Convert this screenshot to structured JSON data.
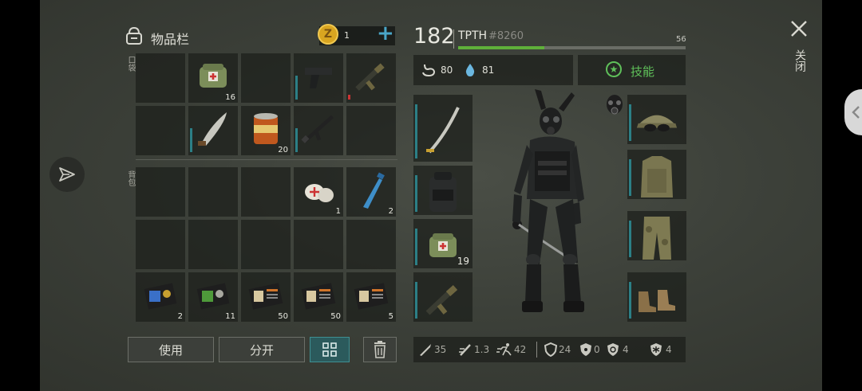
{
  "inventory": {
    "title": "物品栏",
    "coin_count": "1",
    "plus": "+",
    "pocket_label": "口袋",
    "backpack_label": "背包",
    "pocket_slots": [
      {
        "name": "empty"
      },
      {
        "name": "medical-bag",
        "count": "16"
      },
      {
        "name": "empty"
      },
      {
        "name": "pistol"
      },
      {
        "name": "rifle-grenade-launcher"
      },
      {
        "name": "empty"
      },
      {
        "name": "machete"
      },
      {
        "name": "food-can",
        "count": "20"
      },
      {
        "name": "assault-rifle"
      },
      {
        "name": "empty"
      }
    ],
    "backpack_slots": [
      {
        "name": "empty"
      },
      {
        "name": "empty"
      },
      {
        "name": "empty"
      },
      {
        "name": "bandage",
        "count": "1"
      },
      {
        "name": "water-bottle",
        "count": "2"
      },
      {
        "name": "empty"
      },
      {
        "name": "empty"
      },
      {
        "name": "empty"
      },
      {
        "name": "empty"
      },
      {
        "name": "empty"
      },
      {
        "name": "blue-keycard",
        "count": "2"
      },
      {
        "name": "green-keycard",
        "count": "11"
      },
      {
        "name": "recipe-book",
        "count": "50"
      },
      {
        "name": "recipe-book",
        "count": "50"
      },
      {
        "name": "recipe-book",
        "count": "5"
      }
    ],
    "use_button": "使用",
    "split_button": "分开"
  },
  "player": {
    "level": "182",
    "name": "TPTH",
    "tag": "#8260",
    "level_progress_value": "56",
    "level_progress_fraction": 0.38,
    "hunger": "80",
    "thirst": "81",
    "skills_button": "技能",
    "equip_left": [
      {
        "name": "katana"
      },
      {
        "name": "backpack"
      },
      {
        "name": "medical-bag",
        "count": "19"
      },
      {
        "name": "rifle-grenade-launcher"
      }
    ],
    "equip_right": [
      {
        "name": "cap-goggles"
      },
      {
        "name": "body-armor"
      },
      {
        "name": "camo-pants"
      },
      {
        "name": "boots"
      }
    ],
    "stats": {
      "melee": "35",
      "attack_speed": "1.3",
      "move_speed": "42",
      "armor": "24",
      "radiation": "0",
      "bio": "4",
      "cold": "4"
    }
  },
  "window": {
    "close_label": "关闭"
  },
  "colors": {
    "accent_teal": "#2c7f86",
    "progress_green": "#5fb03a",
    "skill_green": "#5fc05a",
    "coin_gold": "#d9a520"
  }
}
